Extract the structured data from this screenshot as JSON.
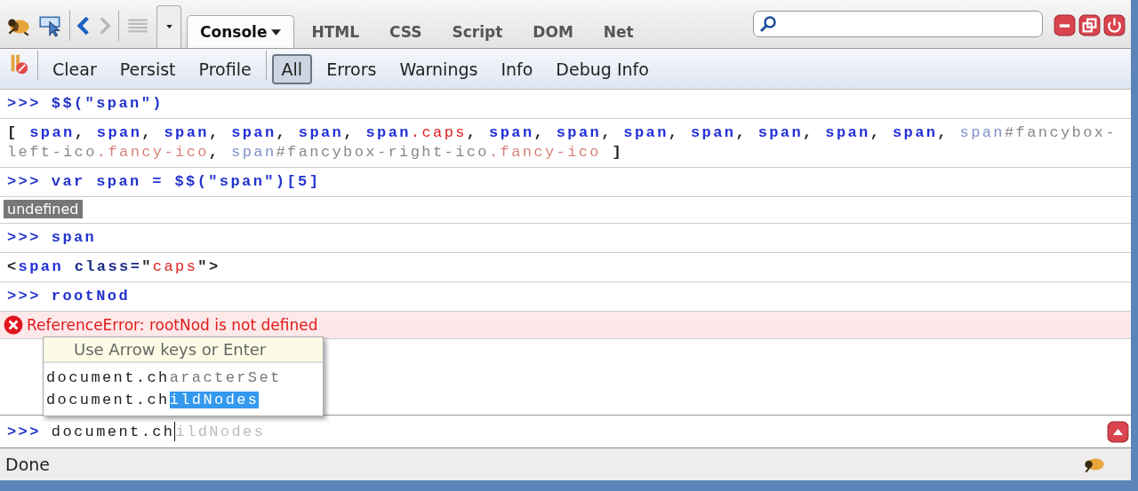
{
  "tabs": [
    {
      "label": "Console",
      "selected": true,
      "dropdown": true
    },
    {
      "label": "HTML",
      "selected": false,
      "dropdown": false
    },
    {
      "label": "CSS",
      "selected": false,
      "dropdown": false
    },
    {
      "label": "Script",
      "selected": false,
      "dropdown": false
    },
    {
      "label": "DOM",
      "selected": false,
      "dropdown": false
    },
    {
      "label": "Net",
      "selected": false,
      "dropdown": false
    }
  ],
  "actions": [
    "Clear",
    "Persist",
    "Profile"
  ],
  "filters": [
    {
      "label": "All",
      "selected": true
    },
    {
      "label": "Errors",
      "selected": false
    },
    {
      "label": "Warnings",
      "selected": false
    },
    {
      "label": "Info",
      "selected": false
    },
    {
      "label": "Debug Info",
      "selected": false
    }
  ],
  "entries": [
    {
      "kind": "command",
      "prompt": ">>>",
      "text": "$$(\"span\")"
    },
    {
      "kind": "output",
      "segments": [
        {
          "kind": "punct",
          "text": "[ "
        },
        {
          "kind": "tag",
          "text": "span"
        },
        {
          "kind": "punct",
          "text": ", "
        },
        {
          "kind": "tag",
          "text": "span"
        },
        {
          "kind": "punct",
          "text": ", "
        },
        {
          "kind": "tag",
          "text": "span"
        },
        {
          "kind": "punct",
          "text": ", "
        },
        {
          "kind": "tag",
          "text": "span"
        },
        {
          "kind": "punct",
          "text": ", "
        },
        {
          "kind": "tag",
          "text": "span"
        },
        {
          "kind": "punct",
          "text": ", "
        },
        {
          "kind": "tag",
          "text": "span"
        },
        {
          "kind": "class",
          "text": ".caps"
        },
        {
          "kind": "punct",
          "text": ", "
        },
        {
          "kind": "tag",
          "text": "span"
        },
        {
          "kind": "punct",
          "text": ", "
        },
        {
          "kind": "tag",
          "text": "span"
        },
        {
          "kind": "punct",
          "text": ", "
        },
        {
          "kind": "tag",
          "text": "span"
        },
        {
          "kind": "punct",
          "text": ", "
        },
        {
          "kind": "tag",
          "text": "span"
        },
        {
          "kind": "punct",
          "text": ", "
        },
        {
          "kind": "tag",
          "text": "span"
        },
        {
          "kind": "punct",
          "text": ", "
        },
        {
          "kind": "tag",
          "text": "span"
        },
        {
          "kind": "punct",
          "text": ", "
        },
        {
          "kind": "tag",
          "text": "span"
        },
        {
          "kind": "punct",
          "text": ", "
        },
        {
          "kind": "tag-dim",
          "text": "span"
        },
        {
          "kind": "id",
          "text": "#fancybox-left-ico"
        },
        {
          "kind": "class-dim",
          "text": ".fancy-ico"
        },
        {
          "kind": "punct",
          "text": ", "
        },
        {
          "kind": "tag-dim",
          "text": "span"
        },
        {
          "kind": "id",
          "text": "#fancybox-right-ico"
        },
        {
          "kind": "class-dim",
          "text": ".fancy-ico"
        },
        {
          "kind": "punct",
          "text": " ]"
        }
      ]
    },
    {
      "kind": "command",
      "prompt": ">>>",
      "text": "var span = $$(\"span\")[5]"
    },
    {
      "kind": "undefined",
      "text": "undefined"
    },
    {
      "kind": "command",
      "prompt": ">>>",
      "text": "span"
    },
    {
      "kind": "output",
      "segments": [
        {
          "kind": "punct",
          "text": "<"
        },
        {
          "kind": "tag",
          "text": "span"
        },
        {
          "kind": "attr",
          "text": " class="
        },
        {
          "kind": "punct",
          "text": "\""
        },
        {
          "kind": "class",
          "text": "caps"
        },
        {
          "kind": "punct",
          "text": "\">"
        }
      ]
    },
    {
      "kind": "command",
      "prompt": ">>>",
      "text": "rootNod"
    },
    {
      "kind": "error",
      "text": "ReferenceError: rootNod is not defined"
    }
  ],
  "autocomplete": {
    "hint": "Use Arrow keys or Enter",
    "options": [
      {
        "typed": "document.ch",
        "rest": "aracterSet",
        "selected": false
      },
      {
        "typed": "document.ch",
        "rest": "ildNodes",
        "selected": true
      }
    ]
  },
  "command_line": {
    "prompt": ">>>",
    "value": "document.ch",
    "completion": "ildNodes"
  },
  "status_bar": {
    "text": "Done"
  }
}
